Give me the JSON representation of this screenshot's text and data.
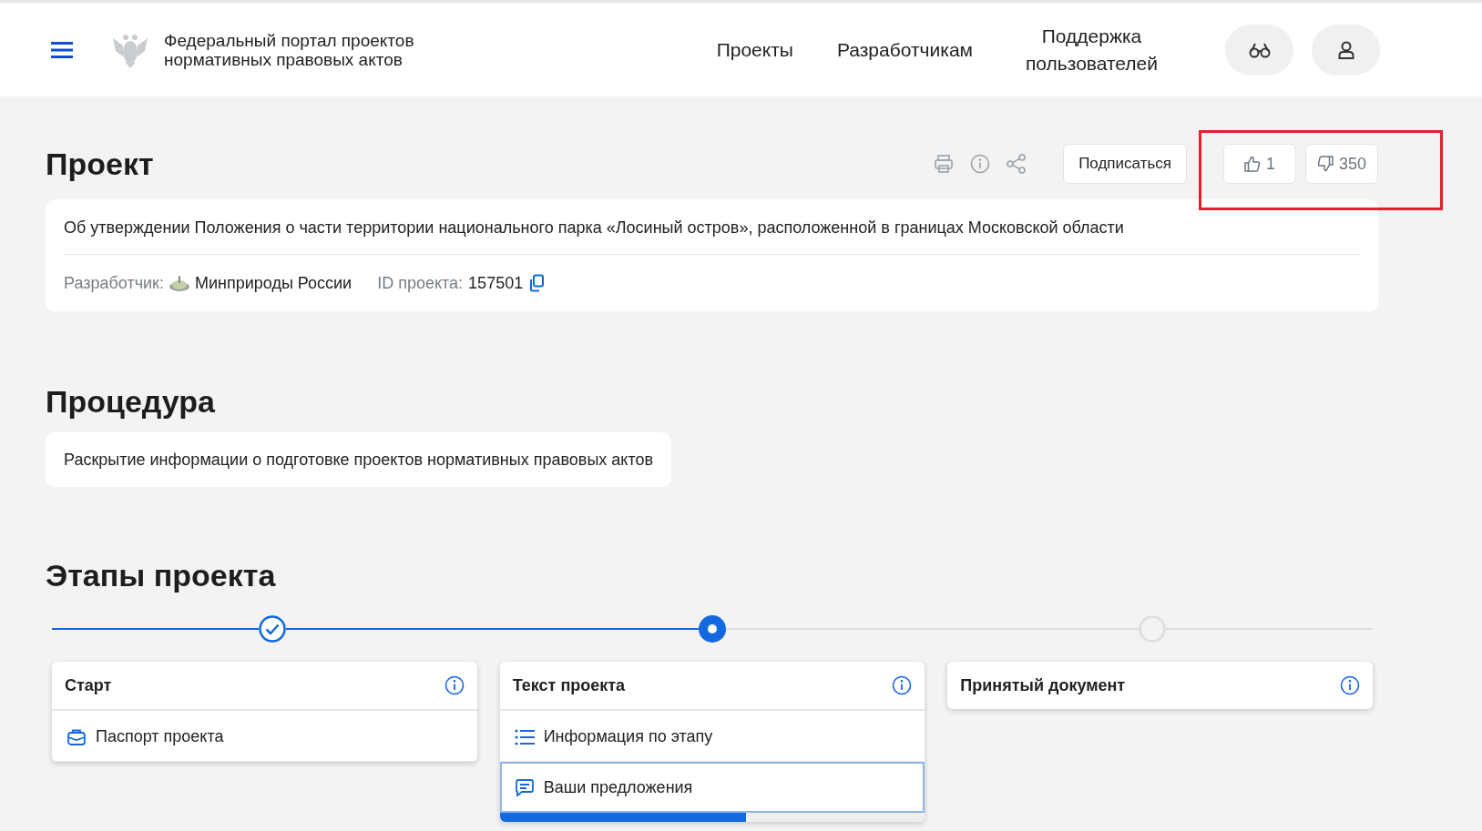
{
  "header": {
    "portal_title": "Федеральный портал проектов нормативных правовых актов",
    "nav": [
      {
        "label": "Проекты"
      },
      {
        "label": "Разработчикам"
      },
      {
        "label": "Поддержка пользователей"
      }
    ]
  },
  "project": {
    "heading": "Проект",
    "subscribe": "Подписаться",
    "likes": "1",
    "dislikes": "350",
    "title": "Об утверждении Положения о части территории национального парка «Лосиный остров», расположенной в границах Московской области",
    "developer_label": "Разработчик:",
    "developer": "Минприроды России",
    "id_label": "ID проекта:",
    "id": "157501"
  },
  "annotation": {
    "kind": "rectangle",
    "color": "#e0202a"
  },
  "procedure": {
    "heading": "Процедура",
    "text": "Раскрытие информации о подготовке проектов нормативных правовых актов"
  },
  "stages": {
    "heading": "Этапы проекта",
    "items": [
      {
        "title": "Старт",
        "kind": "done",
        "items": [
          {
            "label": "Паспорт проекта",
            "kind": "briefcase",
            "selected": false
          }
        ]
      },
      {
        "title": "Текст проекта",
        "kind": "current",
        "items": [
          {
            "label": "Информация по этапу",
            "kind": "list",
            "selected": false
          },
          {
            "label": "Ваши предложения",
            "kind": "comment",
            "selected": true
          }
        ],
        "progress": {
          "level": 0.58
        }
      },
      {
        "title": "Принятый документ",
        "kind": "future"
      }
    ]
  }
}
